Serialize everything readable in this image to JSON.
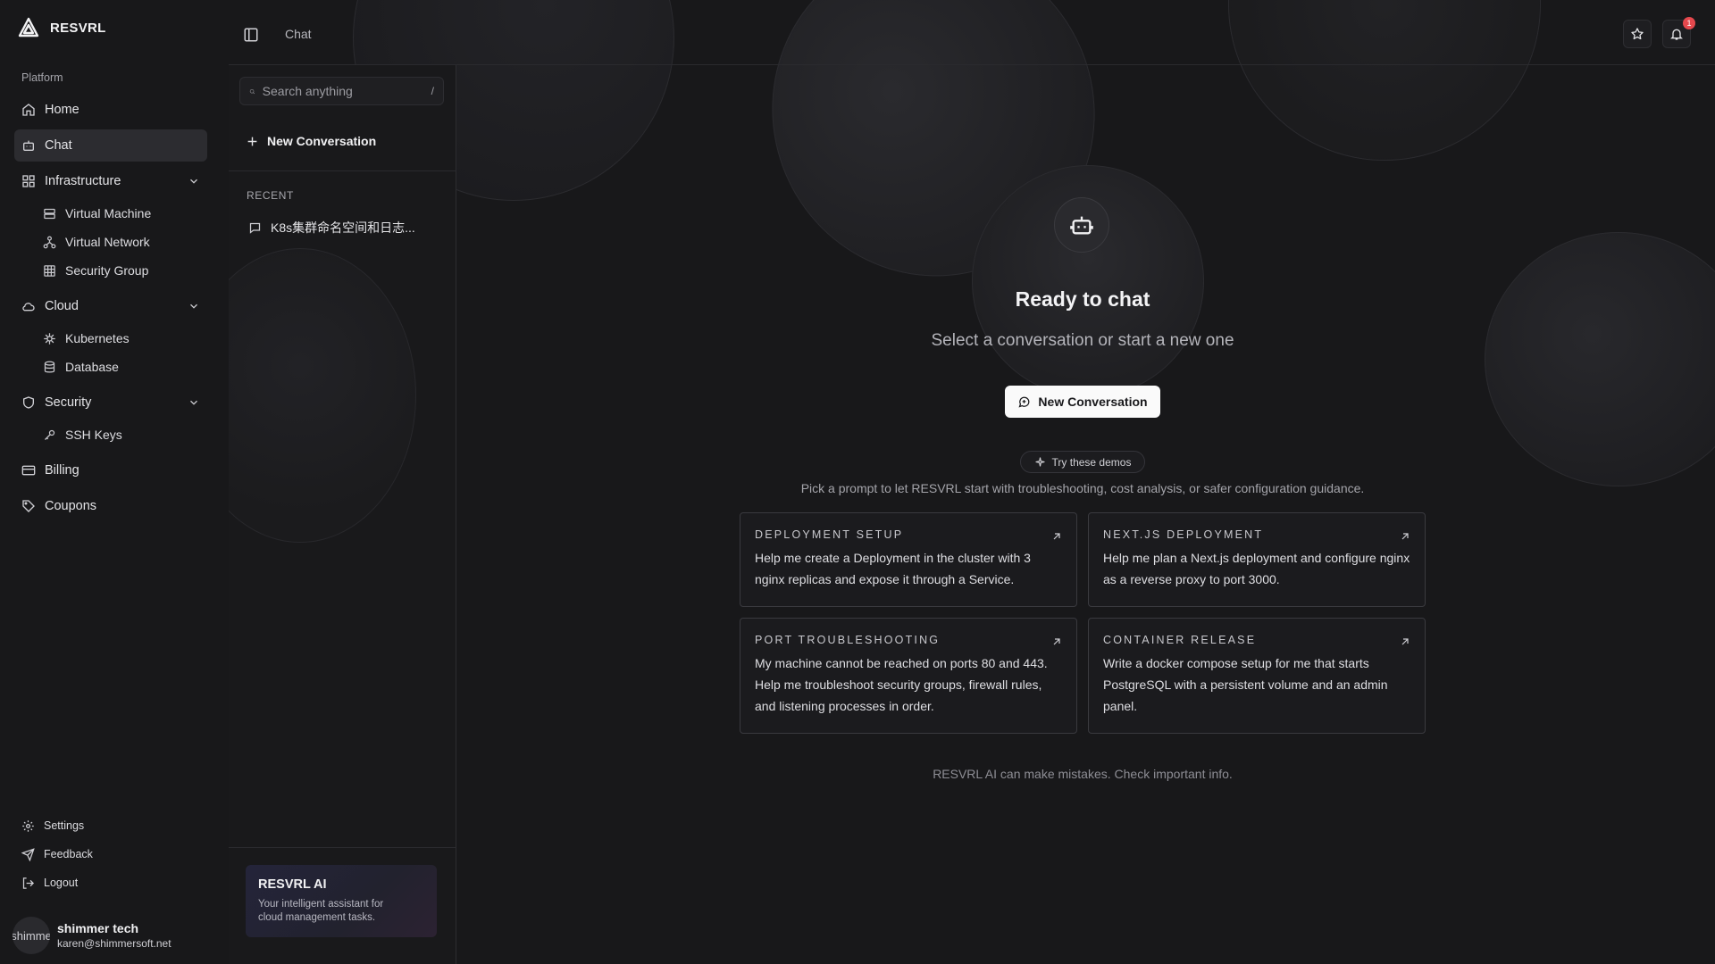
{
  "brand": {
    "name": "RESVRL"
  },
  "sidebar": {
    "section_label": "Platform",
    "items": [
      {
        "label": "Home",
        "icon": "home-icon"
      },
      {
        "label": "Chat",
        "icon": "chat-bot-icon",
        "active": true
      },
      {
        "label": "Infrastructure",
        "icon": "grid-icon",
        "expanded": true,
        "children": [
          {
            "label": "Virtual Machine",
            "icon": "server-icon"
          },
          {
            "label": "Virtual Network",
            "icon": "network-icon"
          },
          {
            "label": "Security Group",
            "icon": "table-icon"
          }
        ]
      },
      {
        "label": "Cloud",
        "icon": "cloud-icon",
        "expanded": true,
        "children": [
          {
            "label": "Kubernetes",
            "icon": "helm-icon"
          },
          {
            "label": "Database",
            "icon": "database-icon"
          }
        ]
      },
      {
        "label": "Security",
        "icon": "shield-icon",
        "expanded": true,
        "children": [
          {
            "label": "SSH Keys",
            "icon": "key-icon"
          }
        ]
      },
      {
        "label": "Billing",
        "icon": "credit-card-icon"
      },
      {
        "label": "Coupons",
        "icon": "tag-icon"
      }
    ],
    "bottom": [
      {
        "label": "Settings",
        "icon": "gear-icon"
      },
      {
        "label": "Feedback",
        "icon": "send-icon"
      },
      {
        "label": "Logout",
        "icon": "logout-icon"
      }
    ],
    "user": {
      "avatar_text": "shimme",
      "name": "shimmer tech",
      "email": "karen@shimmersoft.net"
    }
  },
  "header": {
    "breadcrumb": "Chat",
    "notification_count": "1"
  },
  "panel": {
    "search_placeholder": "Search anything",
    "search_shortcut": "/",
    "new_conversation": "New Conversation",
    "recent_label": "RECENT",
    "recent": [
      {
        "title": "K8s集群命名空间和日志..."
      }
    ],
    "ai_card": {
      "title": "RESVRL AI",
      "description": "Your intelligent assistant for cloud management tasks."
    }
  },
  "main": {
    "title": "Ready to chat",
    "subtitle": "Select a conversation or start a new one",
    "new_conversation_button": "New Conversation",
    "demos_pill": "Try these demos",
    "hint": "Pick a prompt to let RESVRL start with troubleshooting, cost analysis, or safer configuration guidance.",
    "cards": [
      {
        "title": "DEPLOYMENT SETUP",
        "body": "Help me create a Deployment in the cluster with 3 nginx replicas and expose it through a Service."
      },
      {
        "title": "NEXT.JS DEPLOYMENT",
        "body": "Help me plan a Next.js deployment and configure nginx as a reverse proxy to port 3000."
      },
      {
        "title": "PORT TROUBLESHOOTING",
        "body": "My machine cannot be reached on ports 80 and 443. Help me troubleshoot security groups, firewall rules, and listening processes in order."
      },
      {
        "title": "CONTAINER RELEASE",
        "body": "Write a docker compose setup for me that starts PostgreSQL with a persistent volume and an admin panel."
      }
    ],
    "disclaimer": "RESVRL AI can make mistakes. Check important info."
  },
  "colors": {
    "background": "#18181a",
    "primary_button": "#fafafa",
    "badge": "#e5484d"
  }
}
